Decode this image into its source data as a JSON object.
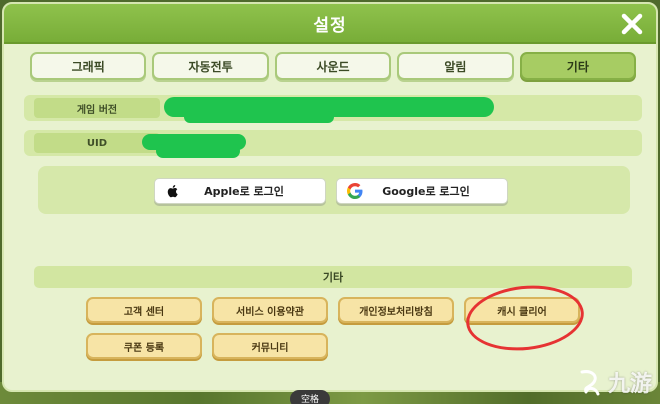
{
  "header": {
    "title": "설정"
  },
  "tabs": [
    {
      "label": "그래픽",
      "active": false
    },
    {
      "label": "자동전투",
      "active": false
    },
    {
      "label": "사운드",
      "active": false
    },
    {
      "label": "알림",
      "active": false
    },
    {
      "label": "기타",
      "active": true
    }
  ],
  "info": {
    "version_label": "게임 버전",
    "version_value": "",
    "uid_label": "UID",
    "uid_value": ""
  },
  "login": {
    "apple_label": "Apple로 로그인",
    "google_label": "Google로 로그인"
  },
  "section": {
    "title": "기타"
  },
  "actions": {
    "customer_center": "고객 센터",
    "terms": "서비스 이용약관",
    "privacy": "개인정보처리방침",
    "cache_clear": "캐시 클리어",
    "coupon": "쿠폰 등록",
    "community": "커뮤니티"
  },
  "overlay": {
    "space_hint": "空格",
    "watermark": "九游"
  },
  "colors": {
    "header": "#78ad38",
    "panel": "#e8f2cf",
    "tab_active": "#a7cc63",
    "action_button": "#f7e4a6",
    "redaction": "#1fc44e",
    "annotation_circle": "#e63333"
  },
  "icons": {
    "close": "close-icon",
    "apple": "apple-logo-icon",
    "google": "google-logo-icon",
    "watermark": "jiuyou-logo-icon"
  }
}
